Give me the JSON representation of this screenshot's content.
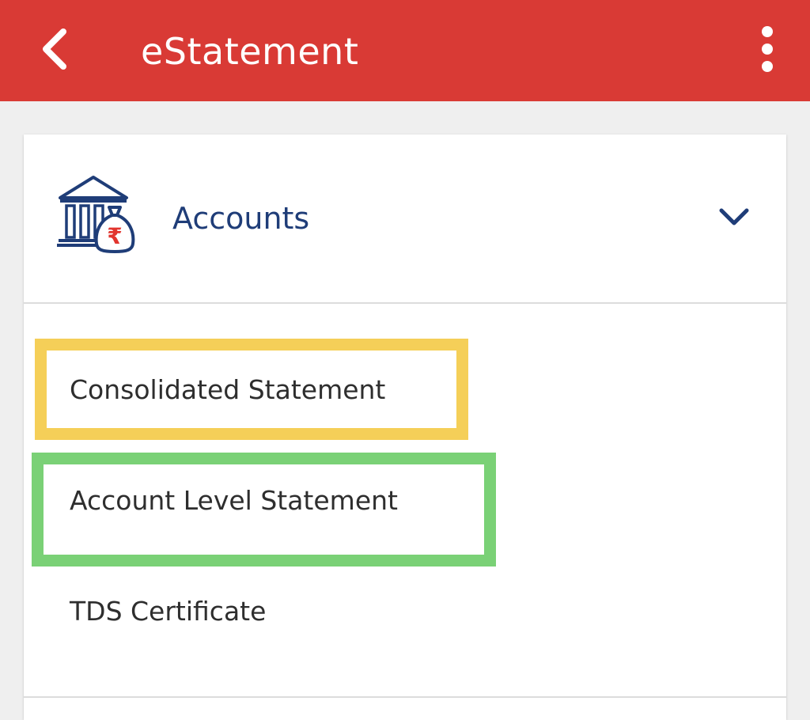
{
  "appbar": {
    "title": "eStatement",
    "back_icon": "arrow-left-icon",
    "menu_icon": "more-vertical-icon",
    "color": "#d93a35"
  },
  "section": {
    "title": "Accounts",
    "icon": "bank-rupee-icon",
    "expand_icon": "chevron-down-icon",
    "title_color": "#1f3d78"
  },
  "items": [
    {
      "label": "Consolidated Statement",
      "highlight": "#f5cf58"
    },
    {
      "label": "Account Level Statement",
      "highlight": "#7ad176"
    },
    {
      "label": "TDS Certificate"
    }
  ]
}
